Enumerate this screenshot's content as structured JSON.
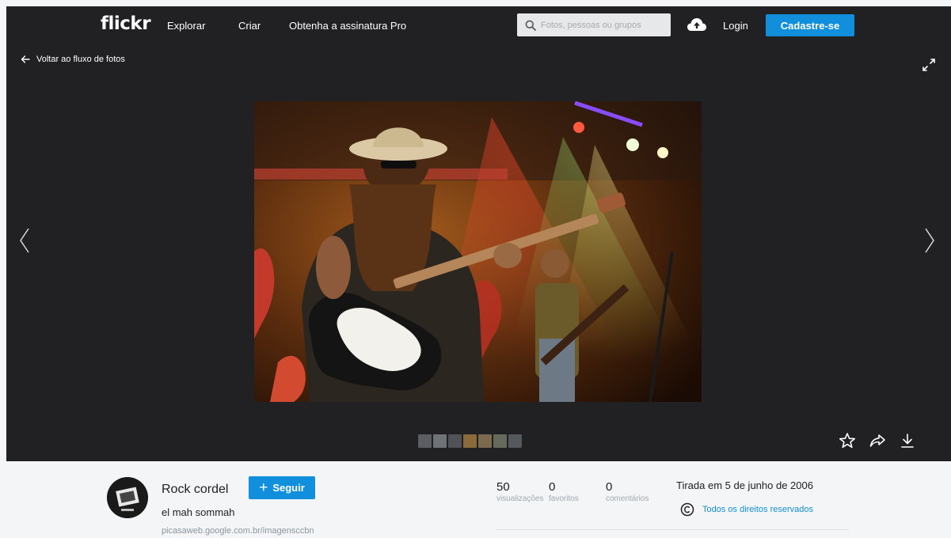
{
  "header": {
    "logo": "flickr",
    "nav": [
      "Explorar",
      "Criar",
      "Obtenha a assinatura Pro"
    ],
    "search_placeholder": "Fotos, pessoas ou grupos",
    "login": "Login",
    "signup": "Cadastre-se"
  },
  "stage": {
    "back_label": "Voltar ao fluxo de fotos",
    "thumbnail_count": 7
  },
  "photo_info": {
    "owner": "Rock cordel",
    "follow_label": "Seguir",
    "title": "el mah sommah",
    "link": "picasaweb.google.com.br/imagensccbn",
    "stats": [
      {
        "value": "50",
        "label": "visualizações"
      },
      {
        "value": "0",
        "label": "favoritos"
      },
      {
        "value": "0",
        "label": "comentários"
      }
    ],
    "taken": "Tirada em 5 de junho de 2006",
    "license": "Todos os direitos reservados"
  },
  "colors": {
    "nav_bg": "#212124",
    "accent": "#128fdc",
    "info_bg": "#f3f5f6"
  },
  "icons": [
    "search-icon",
    "upload-cloud-icon",
    "back-arrow-icon",
    "expand-icon",
    "chevron-left-icon",
    "chevron-right-icon",
    "star-icon",
    "share-icon",
    "download-icon",
    "copyright-icon"
  ]
}
